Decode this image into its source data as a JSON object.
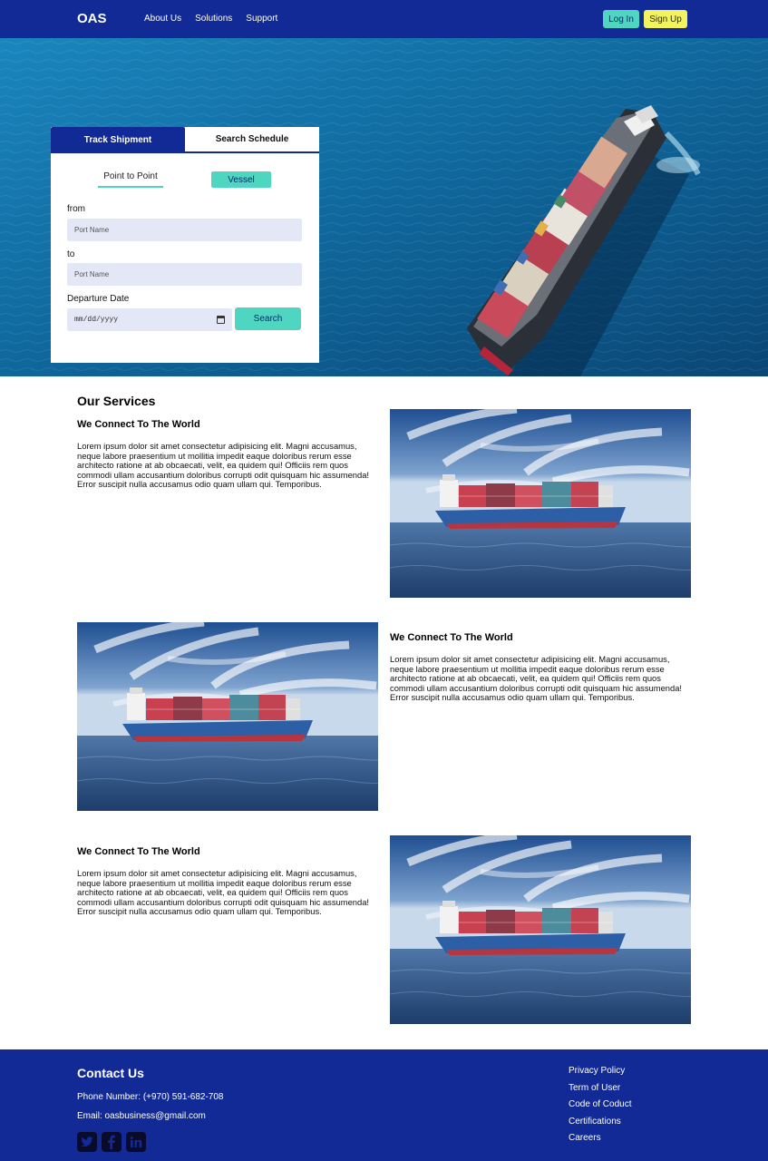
{
  "nav": {
    "brand": "OAS",
    "links": [
      "About Us",
      "Solutions",
      "Support"
    ],
    "login_label": "Log In",
    "signup_label": "Sign Up"
  },
  "search_panel": {
    "tabs": [
      "Track Shipment",
      "Search Schedule"
    ],
    "active_tab": "Track Shipment",
    "subtabs": [
      "Point to Point",
      "Vessel"
    ],
    "from_label": "from",
    "from_placeholder": "Port Name",
    "to_label": "to",
    "to_placeholder": "Port Name",
    "date_label": "Departure Date",
    "date_value": "mm/dd/yyyy",
    "search_label": "Search"
  },
  "services": {
    "title": "Our Services",
    "items": [
      {
        "title": "We Connect To The World",
        "text": "Lorem ipsum dolor sit amet consectetur adipisicing elit. Magni accusamus, neque labore praesentium ut mollitia impedit eaque doloribus rerum esse architecto ratione at ab obcaecati, velit, ea quidem qui! Officiis rem quos commodi ullam accusantium doloribus corrupti odit quisquam hic assumenda! Error suscipit nulla accusamus odio quam ullam qui. Temporibus."
      },
      {
        "title": "We Connect To The World",
        "text": "Lorem ipsum dolor sit amet consectetur adipisicing elit. Magni accusamus, neque labore praesentium ut mollitia impedit eaque doloribus rerum esse architecto ratione at ab obcaecati, velit, ea quidem qui! Officiis rem quos commodi ullam accusantium doloribus corrupti odit quisquam hic assumenda! Error suscipit nulla accusamus odio quam ullam qui. Temporibus."
      },
      {
        "title": "We Connect To The World",
        "text": "Lorem ipsum dolor sit amet consectetur adipisicing elit. Magni accusamus, neque labore praesentium ut mollitia impedit eaque doloribus rerum esse architecto ratione at ab obcaecati, velit, ea quidem qui! Officiis rem quos commodi ullam accusantium doloribus corrupti odit quisquam hic assumenda! Error suscipit nulla accusamus odio quam ullam qui. Temporibus."
      }
    ]
  },
  "footer": {
    "title": "Contact Us",
    "phone": "Phone Number: (+970) 591-682-708",
    "email": "Email: oasbusiness@gmail.com",
    "social_icons": [
      "twitter-icon",
      "facebook-icon",
      "linkedin-icon"
    ],
    "links": [
      "Privacy Policy",
      "Term of User",
      "Code of Coduct",
      "Certifications",
      "Careers"
    ]
  },
  "colors": {
    "primary": "#112a95",
    "accent": "#4fd6c0",
    "signup": "#f3f35f",
    "input_bg": "#e4e8f6"
  }
}
